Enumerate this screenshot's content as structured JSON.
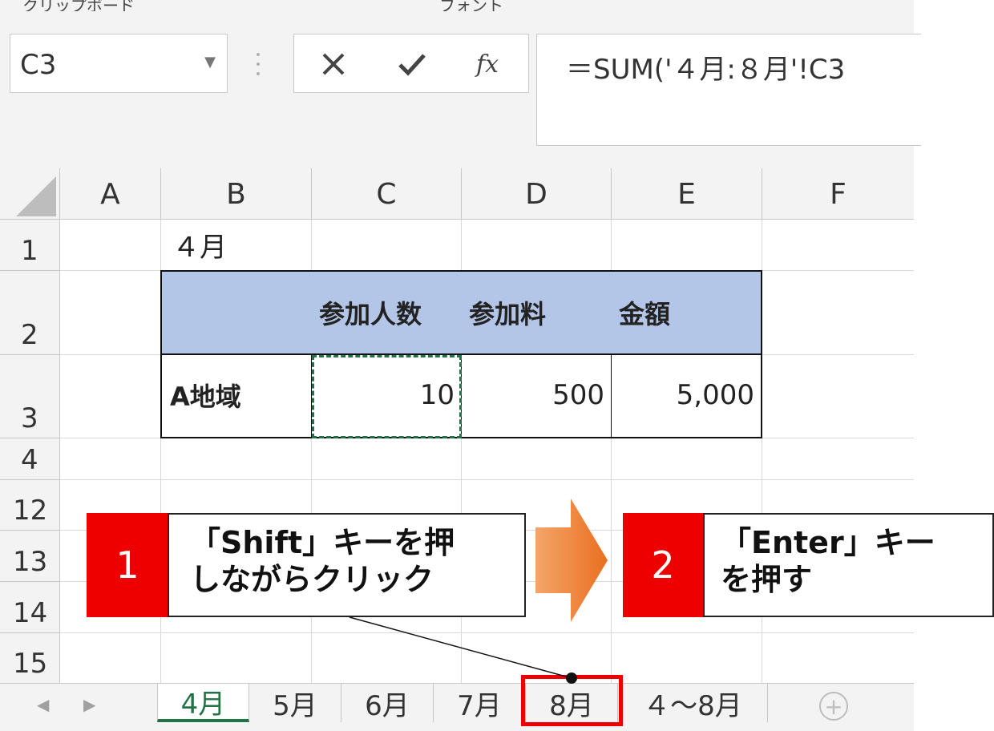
{
  "ribbon": {
    "left_label": "クリップボード",
    "right_label": "フォント"
  },
  "formula_bar": {
    "name_box": "C3",
    "formula": "＝SUM('４月:８月'!C3",
    "cancel_icon": "close-icon",
    "enter_icon": "check-icon",
    "insert_function_label": "fx"
  },
  "columns": [
    "A",
    "B",
    "C",
    "D",
    "E",
    "F"
  ],
  "rows": [
    "1",
    "2",
    "3",
    "4",
    "12",
    "13",
    "14",
    "15"
  ],
  "cells": {
    "B1": "４月",
    "C2": "参加人数",
    "D2": "参加料",
    "E2": "金額",
    "B3": "A地域",
    "C3": "10",
    "D3": "500",
    "E3": "5,000"
  },
  "sheet_tabs": [
    "4月",
    "5月",
    "6月",
    "7月",
    "8月",
    "４～8月"
  ],
  "active_tab": "4月",
  "annotations": {
    "step1": {
      "number": "1",
      "line1": "「Shift」キーを押",
      "line2": "しながらクリック"
    },
    "step2": {
      "number": "2",
      "line1": "「Enter」キー",
      "line2": "を押す"
    }
  },
  "colors": {
    "header_fill": "#b4c6e7",
    "highlight_red": "#ee0000",
    "arrow_orange": "#ed7d31",
    "active_tab_green": "#217346"
  }
}
